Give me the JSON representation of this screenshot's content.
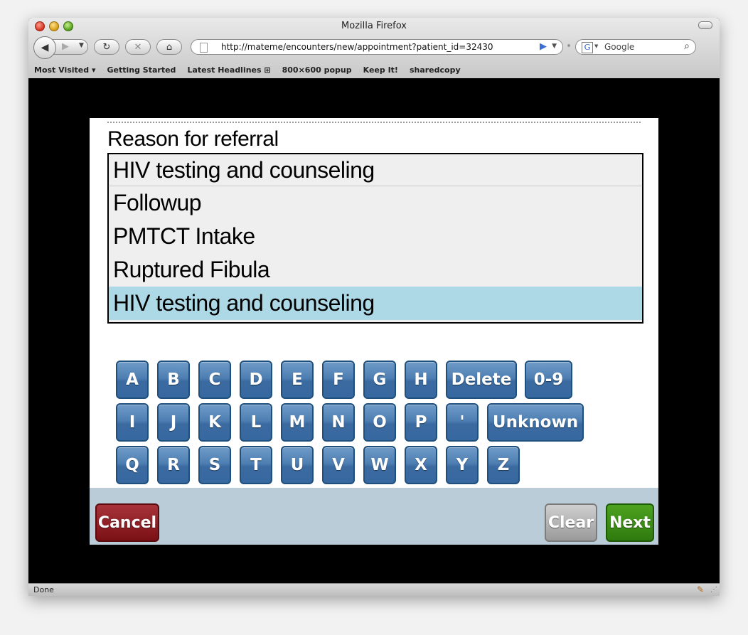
{
  "window": {
    "title": "Mozilla Firefox"
  },
  "toolbar": {
    "url": "http://mateme/encounters/new/appointment?patient_id=32430",
    "search_placeholder": "Google"
  },
  "bookmarks": [
    "Most Visited ▾",
    "Getting Started",
    "Latest Headlines ⊞",
    "800×600 popup",
    "Keep It!",
    "sharedcopy"
  ],
  "page": {
    "question": "Reason for referral",
    "selected_value": "HIV testing and counseling",
    "options": [
      "Followup",
      "PMTCT Intake",
      "Ruptured Fibula",
      "HIV testing and counseling"
    ],
    "selected_option": "HIV testing and counseling"
  },
  "keyboard": {
    "rows": [
      [
        "A",
        "B",
        "C",
        "D",
        "E",
        "F",
        "G",
        "H",
        "Delete",
        "0-9"
      ],
      [
        "I",
        "J",
        "K",
        "L",
        "M",
        "N",
        "O",
        "P",
        "'",
        "Unknown"
      ],
      [
        "Q",
        "R",
        "S",
        "T",
        "U",
        "V",
        "W",
        "X",
        "Y",
        "Z"
      ]
    ]
  },
  "buttons": {
    "cancel": "Cancel",
    "clear": "Clear",
    "next": "Next"
  },
  "colors": {
    "key_blue": "#4e7fb2",
    "selected_row": "#add8e6",
    "cancel": "#8a1d23",
    "next": "#3d8c16",
    "clear": "#aaaaaa",
    "bottom_bar": "#b9ccd8"
  },
  "status": {
    "text": "Done"
  }
}
